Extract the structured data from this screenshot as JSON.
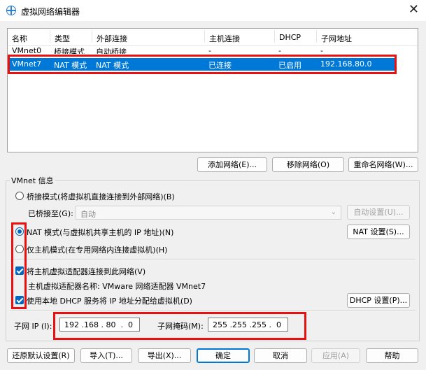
{
  "window": {
    "title": "虚拟网络编辑器",
    "close": "✕"
  },
  "table": {
    "headers": [
      "名称",
      "类型",
      "外部连接",
      "主机连接",
      "DHCP",
      "子网地址"
    ],
    "rows": [
      [
        "VMnet0",
        "桥接模式",
        "自动桥接",
        "-",
        "-",
        "-"
      ],
      [
        "VMnet7",
        "NAT 模式",
        "NAT 模式",
        "已连接",
        "已启用",
        "192.168.80.0"
      ]
    ],
    "selected_row": 1
  },
  "list_buttons": {
    "add": "添加网络(E)...",
    "remove": "移除网络(O)",
    "rename": "重命名网络(W)..."
  },
  "vmnet_info": {
    "group_label": "VMnet 信息",
    "bridge_mode": "桥接模式(将虚拟机直接连接到外部网络)(B)",
    "bridged_to_label": "已桥接至(G):",
    "bridged_to_value": "自动",
    "auto_settings": "自动设置(U)...",
    "nat_mode": "NAT 模式(与虚拟机共享主机的 IP 地址)(N)",
    "nat_settings": "NAT 设置(S)...",
    "host_only": "仅主机模式(在专用网络内连接虚拟机)(H)",
    "connect_adapter": "将主机虚拟适配器连接到此网络(V)",
    "adapter_name": "主机虚拟适配器名称: VMware 网络适配器 VMnet7",
    "use_dhcp": "使用本地 DHCP 服务将 IP 地址分配给虚拟机(D)",
    "dhcp_settings": "DHCP 设置(P)...",
    "subnet_ip_label": "子网 IP (I):",
    "subnet_ip": "192 .168 . 80  .  0",
    "subnet_mask_label": "子网掩码(M):",
    "subnet_mask": "255 .255 .255 .  0",
    "selected_mode": "nat",
    "connect_adapter_checked": true,
    "use_dhcp_checked": true
  },
  "footer": {
    "restore": "还原默认设置(R)",
    "import": "导入(T)...",
    "export": "导出(X)...",
    "ok": "确定",
    "cancel": "取消",
    "apply": "应用(A)",
    "help": "帮助"
  },
  "annotation_color": "#e81010"
}
